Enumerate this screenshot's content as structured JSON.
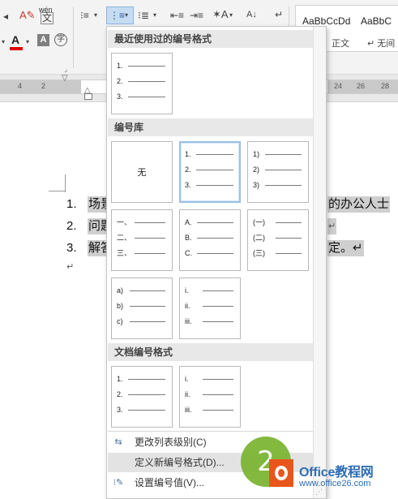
{
  "ribbon": {
    "phonetic_label": "wén",
    "phonetic_char": "文",
    "enclose_char": "字",
    "sort_label": "A↓",
    "styles": [
      {
        "sample": "AaBbCcDd",
        "name": "正文"
      },
      {
        "sample": "AaBbC",
        "name": "↵ 无间"
      }
    ],
    "colors": {
      "font_red": "#e00000",
      "highlight_blue": "#2b579a"
    }
  },
  "ruler": {
    "numbers": [
      "4",
      "2",
      "24",
      "26",
      "28"
    ]
  },
  "document": {
    "lines": [
      {
        "number": "1.",
        "left_text": "场景",
        "right_text": "的办公人士"
      },
      {
        "number": "2.",
        "left_text": "问题",
        "right_text": "↵"
      },
      {
        "number": "3.",
        "left_text": "解答",
        "right_text": "定。↵"
      }
    ],
    "paragraph_mark": "↵"
  },
  "numbering_menu": {
    "sections": {
      "recent": "最近使用过的编号格式",
      "library": "编号库",
      "document": "文档编号格式"
    },
    "none_label": "无",
    "tiles": {
      "recent_1": [
        "1.",
        "2.",
        "3."
      ],
      "lib_arabic_dot": [
        "1.",
        "2.",
        "3."
      ],
      "lib_arabic_paren": [
        "1)",
        "2)",
        "3)"
      ],
      "lib_chinese": [
        "一、",
        "二、",
        "三、"
      ],
      "lib_upper_alpha": [
        "A.",
        "B.",
        "C."
      ],
      "lib_chinese_paren": [
        "(一)",
        "(二)",
        "(三)"
      ],
      "lib_lower_alpha": [
        "a)",
        "b)",
        "c)"
      ],
      "lib_roman": [
        "i.",
        "ii.",
        "iii."
      ],
      "doc_arabic": [
        "1.",
        "2.",
        "3."
      ],
      "doc_roman": [
        "i.",
        "ii.",
        "iii."
      ]
    },
    "commands": {
      "change_level": "更改列表级别(C)",
      "define_new": "定义新编号格式(D)...",
      "set_value": "设置编号值(V)..."
    }
  },
  "overlay": {
    "step": "2",
    "watermark_title": "Office教程网",
    "watermark_url": "www.office26.com",
    "colors": {
      "step": "#79b42e",
      "watermark": "#2d6db5",
      "logo_orange": "#e8561b"
    }
  }
}
